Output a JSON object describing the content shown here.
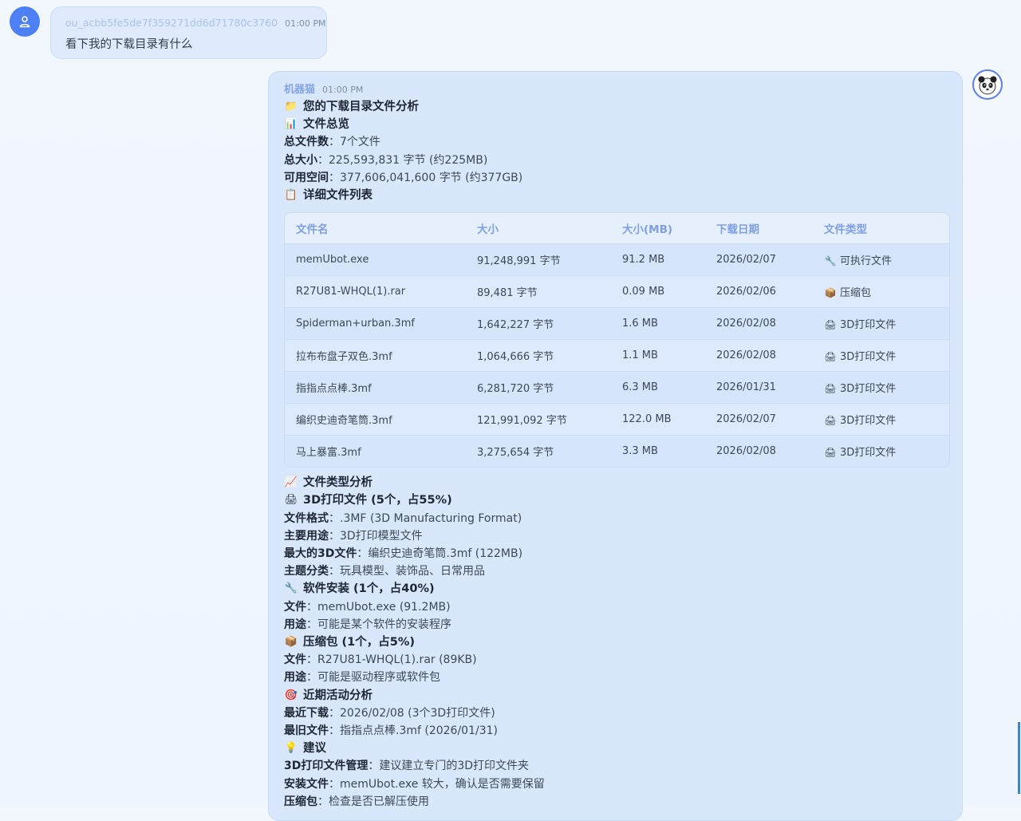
{
  "user_message": {
    "sender": "ou_acbb5fe5de7f359271dd6d71780c3760",
    "time": "01:00 PM",
    "text": "看下我的下载目录有什么"
  },
  "bot_message": {
    "sender": "机器猫",
    "time": "01:00 PM",
    "title": "您的下载目录文件分析",
    "overview_heading": "文件总览",
    "overview": [
      {
        "label": "总文件数",
        "value": "7个文件"
      },
      {
        "label": "总大小",
        "value": "225,593,831 字节 (约225MB)"
      },
      {
        "label": "可用空间",
        "value": "377,606,041,600 字节 (约377GB)"
      }
    ],
    "list_heading": "详细文件列表",
    "table": {
      "headers": [
        "文件名",
        "大小",
        "大小(MB)",
        "下载日期",
        "文件类型"
      ],
      "rows": [
        {
          "name": "memUbot.exe",
          "size": "91,248,991 字节",
          "mb": "91.2 MB",
          "date": "2026/02/07",
          "type": "可执行文件",
          "icon": "wrench-icon"
        },
        {
          "name": "R27U81-WHQL(1).rar",
          "size": "89,481 字节",
          "mb": "0.09 MB",
          "date": "2026/02/06",
          "type": "压缩包",
          "icon": "package-icon"
        },
        {
          "name": "Spiderman+urban.3mf",
          "size": "1,642,227 字节",
          "mb": "1.6 MB",
          "date": "2026/02/08",
          "type": "3D打印文件",
          "icon": "printer-icon"
        },
        {
          "name": "拉布布盘子双色.3mf",
          "size": "1,064,666 字节",
          "mb": "1.1 MB",
          "date": "2026/02/08",
          "type": "3D打印文件",
          "icon": "printer-icon"
        },
        {
          "name": "指指点点棒.3mf",
          "size": "6,281,720 字节",
          "mb": "6.3 MB",
          "date": "2026/01/31",
          "type": "3D打印文件",
          "icon": "printer-icon"
        },
        {
          "name": "编织史迪奇笔筒.3mf",
          "size": "121,991,092 字节",
          "mb": "122.0 MB",
          "date": "2026/02/07",
          "type": "3D打印文件",
          "icon": "printer-icon"
        },
        {
          "name": "马上暴富.3mf",
          "size": "3,275,654 字节",
          "mb": "3.3 MB",
          "date": "2026/02/08",
          "type": "3D打印文件",
          "icon": "printer-icon"
        }
      ]
    },
    "type_heading": "文件类型分析",
    "print_heading": "3D打印文件 (5个，占55%)",
    "print_details": [
      {
        "label": "文件格式",
        "value": ".3MF (3D Manufacturing Format)"
      },
      {
        "label": "主要用途",
        "value": "3D打印模型文件"
      },
      {
        "label": "最大的3D文件",
        "value": "编织史迪奇笔筒.3mf (122MB)"
      },
      {
        "label": "主题分类",
        "value": "玩具模型、装饰品、日常用品"
      }
    ],
    "software_heading": "软件安装 (1个，占40%)",
    "software_details": [
      {
        "label": "文件",
        "value": "memUbot.exe (91.2MB)"
      },
      {
        "label": "用途",
        "value": "可能是某个软件的安装程序"
      }
    ],
    "archive_heading": "压缩包 (1个，占5%)",
    "archive_details": [
      {
        "label": "文件",
        "value": "R27U81-WHQL(1).rar (89KB)"
      },
      {
        "label": "用途",
        "value": "可能是驱动程序或软件包"
      }
    ],
    "activity_heading": "近期活动分析",
    "activity_details": [
      {
        "label": "最近下载",
        "value": "2026/02/08 (3个3D打印文件)"
      },
      {
        "label": "最旧文件",
        "value": "指指点点棒.3mf (2026/01/31)"
      }
    ],
    "advice_heading": "建议",
    "advice_details": [
      {
        "label": "3D打印文件管理",
        "value": "建议建立专门的3D打印文件夹"
      },
      {
        "label": "安装文件",
        "value": "memUbot.exe 较大，确认是否需要保留"
      },
      {
        "label": "压缩包",
        "value": "检查是否已解压使用"
      }
    ]
  },
  "colors": {
    "accent": "#4d7ff5",
    "bubble_user": "#dfebfd",
    "bubble_bot": "#d9e7fc",
    "header_text": "#7ea0e4"
  }
}
